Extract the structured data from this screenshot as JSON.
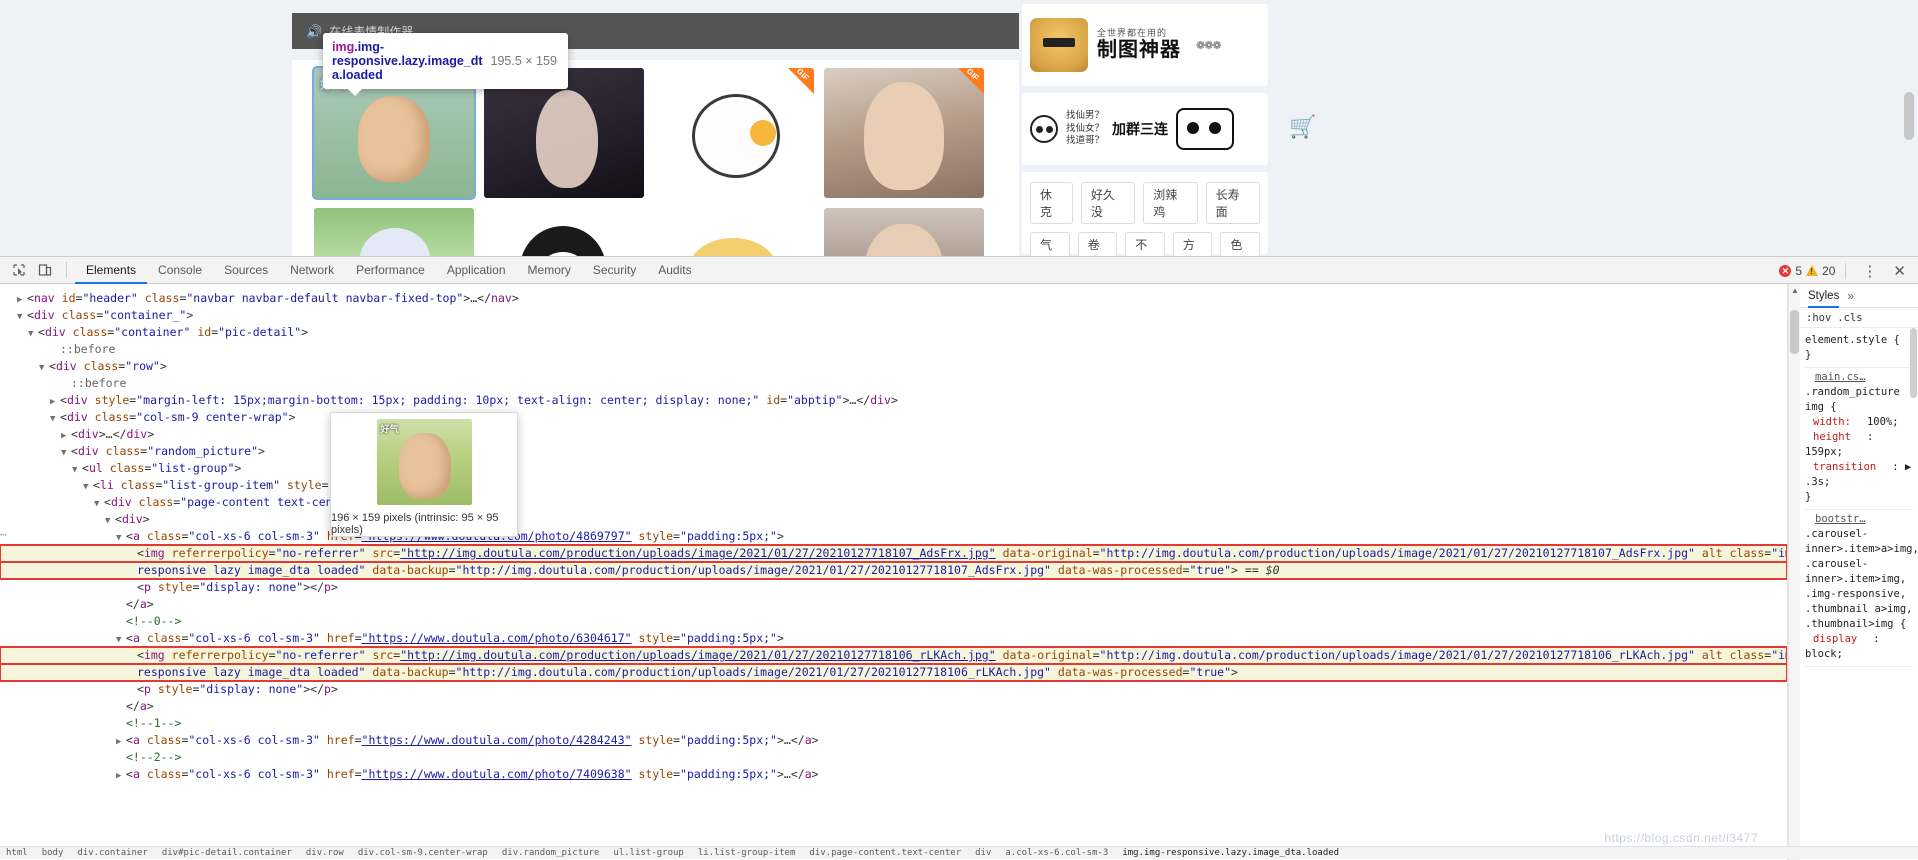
{
  "page": {
    "banner": {
      "icon": "speaker-icon",
      "text": "在线表情制作器"
    },
    "inspect_tooltip": {
      "tag": "img",
      "classes": ".img-responsive.lazy.image_dt",
      "classes_wrap": "a.loaded",
      "dimensions": "195.5 × 159"
    },
    "thumbnails": [
      {
        "label": "好气",
        "gif": false
      },
      {
        "label": "",
        "gif": false
      },
      {
        "label": "",
        "gif": true
      },
      {
        "label": "",
        "gif": true
      },
      {
        "label": "",
        "gif": false
      },
      {
        "label": "",
        "gif": false
      },
      {
        "label": "",
        "gif": false
      },
      {
        "label": "",
        "gif": false
      }
    ],
    "ads": {
      "box1": {
        "small": "全世界都在用的",
        "big": "制图神器",
        "deco": "❁❁❁"
      },
      "box2": {
        "line1": "找仙男？",
        "line2": "找仙女？",
        "line3": "找道哥？",
        "button": "加群三连"
      },
      "tags_row1": [
        "休克",
        "好久没",
        "浏辣鸡",
        "长寿面"
      ],
      "tags_row2": [
        "气短",
        "卷婆",
        "不杀",
        "方位",
        "色行"
      ]
    },
    "cart_icon": "shopping-cart-icon"
  },
  "devtools": {
    "toolbar": {
      "inspect_icon": "inspect-element-icon",
      "device_icon": "device-toolbar-icon",
      "tabs": [
        "Elements",
        "Console",
        "Sources",
        "Network",
        "Performance",
        "Application",
        "Memory",
        "Security",
        "Audits"
      ],
      "active_tab": "Elements",
      "error_count": "5",
      "warning_count": "20",
      "more_icon": "kebab-menu-icon",
      "close_icon": "close-icon"
    },
    "dom_lines": [
      {
        "indent": 1,
        "arrow": "closed",
        "html": "<span class='pun'>&lt;</span><span class='tw'>nav</span> <span class='at'>id</span><span class='pun'>=</span><span class='av'>\"header\"</span> <span class='at'>class</span><span class='pun'>=</span><span class='av'>\"navbar navbar-default navbar-fixed-top\"</span><span class='pun'>&gt;</span><span class='pun'>…</span><span class='pun'>&lt;/</span><span class='tw'>nav</span><span class='pun'>&gt;</span>"
      },
      {
        "indent": 1,
        "arrow": "open",
        "html": "<span class='pun'>&lt;</span><span class='tw'>div</span> <span class='at'>class</span><span class='pun'>=</span><span class='av'>\"container_\"</span><span class='pun'>&gt;</span>"
      },
      {
        "indent": 2,
        "arrow": "open",
        "html": "<span class='pun'>&lt;</span><span class='tw'>div</span> <span class='at'>class</span><span class='pun'>=</span><span class='av'>\"container\"</span> <span class='at'>id</span><span class='pun'>=</span><span class='av'>\"pic-detail\"</span><span class='pun'>&gt;</span>"
      },
      {
        "indent": 4,
        "arrow": "none",
        "html": "<span class='ps'>::before</span>"
      },
      {
        "indent": 3,
        "arrow": "open",
        "html": "<span class='pun'>&lt;</span><span class='tw'>div</span> <span class='at'>class</span><span class='pun'>=</span><span class='av'>\"row\"</span><span class='pun'>&gt;</span>"
      },
      {
        "indent": 5,
        "arrow": "none",
        "html": "<span class='ps'>::before</span>"
      },
      {
        "indent": 4,
        "arrow": "closed",
        "html": "<span class='pun'>&lt;</span><span class='tw'>div</span> <span class='at'>style</span><span class='pun'>=</span><span class='av'>\"margin-left: 15px;margin-bottom: 15px; padding: 10px; text-align: center; display: none;\"</span> <span class='at'>id</span><span class='pun'>=</span><span class='av'>\"abptip\"</span><span class='pun'>&gt;</span><span class='pun'>…</span><span class='pun'>&lt;/</span><span class='tw'>div</span><span class='pun'>&gt;</span>"
      },
      {
        "indent": 4,
        "arrow": "open",
        "html": "<span class='pun'>&lt;</span><span class='tw'>div</span> <span class='at'>class</span><span class='pun'>=</span><span class='av'>\"col-sm-9 center-wrap\"</span><span class='pun'>&gt;</span>"
      },
      {
        "indent": 5,
        "arrow": "closed",
        "html": "<span class='pun'>&lt;</span><span class='tw'>div</span><span class='pun'>&gt;</span><span class='pun'>…</span><span class='pun'>&lt;/</span><span class='tw'>div</span><span class='pun'>&gt;</span>"
      },
      {
        "indent": 5,
        "arrow": "open",
        "html": "<span class='pun'>&lt;</span><span class='tw'>div</span> <span class='at'>class</span><span class='pun'>=</span><span class='av'>\"random_picture\"</span><span class='pun'>&gt;</span>"
      },
      {
        "indent": 6,
        "arrow": "open",
        "html": "<span class='pun'>&lt;</span><span class='tw'>ul</span> <span class='at'>class</span><span class='pun'>=</span><span class='av'>\"list-group\"</span><span class='pun'>&gt;</span>"
      },
      {
        "indent": 7,
        "arrow": "open",
        "html": "<span class='pun'>&lt;</span><span class='tw'>li</span> <span class='at'>class</span><span class='pun'>=</span><span class='av'>\"list-group-item\"</span> <span class='at'>style</span><span class='pun'>=</span><span class='av'>\"margin-bot</span>"
      },
      {
        "indent": 8,
        "arrow": "open",
        "html": "<span class='pun'>&lt;</span><span class='tw'>div</span> <span class='at'>class</span><span class='pun'>=</span><span class='av'>\"page-content text-center\"</span><span class='pun'>&gt;</span>"
      },
      {
        "indent": 9,
        "arrow": "open",
        "html": "<span class='pun'>&lt;</span><span class='tw'>div</span><span class='pun'>&gt;</span>"
      },
      {
        "indent": 10,
        "arrow": "open",
        "html": "<span class='pun'>&lt;</span><span class='tw'>a</span> <span class='at'>class</span><span class='pun'>=</span><span class='av'>\"col-xs-6 col-sm-3\"</span> <span class='at'>href</span><span class='pun'>=</span><span class='lnk'>\"https://www.doutula.com/photo/4869797\"</span> <span class='at'>style</span><span class='pun'>=</span><span class='av'>\"padding:5px;\"</span><span class='pun'>&gt;</span>"
      },
      {
        "indent": 11,
        "arrow": "none",
        "highlighted": true,
        "html": "<span class='pun'>&lt;</span><span class='tw'>img</span> <span class='at'>referrerpolicy</span><span class='pun'>=</span><span class='av'>\"no-referrer\"</span> <span class='at'>src</span><span class='pun'>=</span><span class='lnk'>\"http://img.doutula.com/production/uploads/image/2021/01/27/20210127718107_AdsFrx.jpg\"</span> <span class='at'>data-original</span><span class='pun'>=</span><span class='av'>\"http://img.doutula.com/production/uploads/image/2021/01/27/20210127718107_AdsFrx.jpg\"</span> <span class='at'>alt</span> <span class='at'>class</span><span class='pun'>=</span><span class='av'>\"img-</span>"
      },
      {
        "indent": 11,
        "arrow": "none",
        "highlighted": true,
        "html": "<span class='av'>responsive lazy image_dta loaded\"</span> <span class='at'>data-backup</span><span class='pun'>=</span><span class='av'>\"http://img.doutula.com/production/uploads/image/2021/01/27/20210127718107_AdsFrx.jpg\"</span> <span class='at'>data-was-processed</span><span class='pun'>=</span><span class='av'>\"true\"</span><span class='pun'>&gt;</span> <span class='sel0'>== $0</span>"
      },
      {
        "indent": 11,
        "arrow": "none",
        "html": "<span class='pun'>&lt;</span><span class='tw'>p</span> <span class='at'>style</span><span class='pun'>=</span><span class='av'>\"display: none\"</span><span class='pun'>&gt;&lt;/</span><span class='tw'>p</span><span class='pun'>&gt;</span>"
      },
      {
        "indent": 10,
        "arrow": "none",
        "html": "<span class='pun'>&lt;/</span><span class='tw'>a</span><span class='pun'>&gt;</span>"
      },
      {
        "indent": 10,
        "arrow": "none",
        "html": "<span class='cm'>&lt;!--0--&gt;</span>"
      },
      {
        "indent": 10,
        "arrow": "open",
        "html": "<span class='pun'>&lt;</span><span class='tw'>a</span> <span class='at'>class</span><span class='pun'>=</span><span class='av'>\"col-xs-6 col-sm-3\"</span> <span class='at'>href</span><span class='pun'>=</span><span class='lnk'>\"https://www.doutula.com/photo/6304617\"</span> <span class='at'>style</span><span class='pun'>=</span><span class='av'>\"padding:5px;\"</span><span class='pun'>&gt;</span>"
      },
      {
        "indent": 11,
        "arrow": "none",
        "highlighted": true,
        "html": "<span class='pun'>&lt;</span><span class='tw'>img</span> <span class='at'>referrerpolicy</span><span class='pun'>=</span><span class='av'>\"no-referrer\"</span> <span class='at'>src</span><span class='pun'>=</span><span class='lnk'>\"http://img.doutula.com/production/uploads/image/2021/01/27/20210127718106_rLKAch.jpg\"</span> <span class='at'>data-original</span><span class='pun'>=</span><span class='av'>\"http://img.doutula.com/production/uploads/image/2021/01/27/20210127718106_rLKAch.jpg\"</span> <span class='at'>alt</span> <span class='at'>class</span><span class='pun'>=</span><span class='av'>\"img-</span>"
      },
      {
        "indent": 11,
        "arrow": "none",
        "highlighted": true,
        "html": "<span class='av'>responsive lazy image_dta loaded\"</span> <span class='at'>data-backup</span><span class='pun'>=</span><span class='av'>\"http://img.doutula.com/production/uploads/image/2021/01/27/20210127718106_rLKAch.jpg\"</span> <span class='at'>data-was-processed</span><span class='pun'>=</span><span class='av'>\"true\"</span><span class='pun'>&gt;</span>"
      },
      {
        "indent": 11,
        "arrow": "none",
        "html": "<span class='pun'>&lt;</span><span class='tw'>p</span> <span class='at'>style</span><span class='pun'>=</span><span class='av'>\"display: none\"</span><span class='pun'>&gt;&lt;/</span><span class='tw'>p</span><span class='pun'>&gt;</span>"
      },
      {
        "indent": 10,
        "arrow": "none",
        "html": "<span class='pun'>&lt;/</span><span class='tw'>a</span><span class='pun'>&gt;</span>"
      },
      {
        "indent": 10,
        "arrow": "none",
        "html": "<span class='cm'>&lt;!--1--&gt;</span>"
      },
      {
        "indent": 10,
        "arrow": "closed",
        "html": "<span class='pun'>&lt;</span><span class='tw'>a</span> <span class='at'>class</span><span class='pun'>=</span><span class='av'>\"col-xs-6 col-sm-3\"</span> <span class='at'>href</span><span class='pun'>=</span><span class='lnk'>\"https://www.doutula.com/photo/4284243\"</span> <span class='at'>style</span><span class='pun'>=</span><span class='av'>\"padding:5px;\"</span><span class='pun'>&gt;</span><span class='pun'>…</span><span class='pun'>&lt;/</span><span class='tw'>a</span><span class='pun'>&gt;</span>"
      },
      {
        "indent": 10,
        "arrow": "none",
        "html": "<span class='cm'>&lt;!--2--&gt;</span>"
      },
      {
        "indent": 10,
        "arrow": "closed",
        "html": "<span class='pun'>&lt;</span><span class='tw'>a</span> <span class='at'>class</span><span class='pun'>=</span><span class='av'>\"col-xs-6 col-sm-3\"</span> <span class='at'>href</span><span class='pun'>=</span><span class='lnk'>\"https://www.doutula.com/photo/7409638\"</span> <span class='at'>style</span><span class='pun'>=</span><span class='av'>\"padding:5px;\"</span><span class='pun'>&gt;</span><span class='pun'>…</span><span class='pun'>&lt;/</span><span class='tw'>a</span><span class='pun'>&gt;</span>"
      }
    ],
    "image_preview": {
      "label": "好气",
      "caption": "196 × 159 pixels (intrinsic: 95 × 95 pixels)"
    },
    "styles": {
      "tab_label": "Styles",
      "more_icon": "chevron-double-right-icon",
      "hov_label": ":hov",
      "cls_label": ".cls",
      "rules": [
        {
          "source": "",
          "selector": "element.style {",
          "declarations": [],
          "close": "}"
        },
        {
          "source": "main.cs…",
          "selector": ".random_picture img {",
          "declarations": [
            {
              "prop": "width:",
              "value": "100%;"
            },
            {
              "prop": "height",
              "value": ": 159px;"
            },
            {
              "prop": "transition",
              "value": ": ▶ .3s;"
            }
          ],
          "close": "}"
        },
        {
          "source": "bootstr…",
          "selector": ".carousel-inner>.item>a>img, .carousel-inner>.item>img, .img-responsive, .thumbnail a>img, .thumbnail>img {",
          "declarations": [
            {
              "prop": "display",
              "value": ": block;"
            }
          ],
          "close": ""
        }
      ]
    },
    "breadcrumbs": [
      "html",
      "body",
      "div.container",
      "div#pic-detail.container",
      "div.row",
      "div.col-sm-9.center-wrap",
      "div.random_picture",
      "ul.list-group",
      "li.list-group-item",
      "div.page-content.text-center",
      "div",
      "a.col-xs-6.col-sm-3",
      "img.img-responsive.lazy.image_dta.loaded"
    ],
    "watermark": "https://blog.csdn.net/i3477"
  }
}
